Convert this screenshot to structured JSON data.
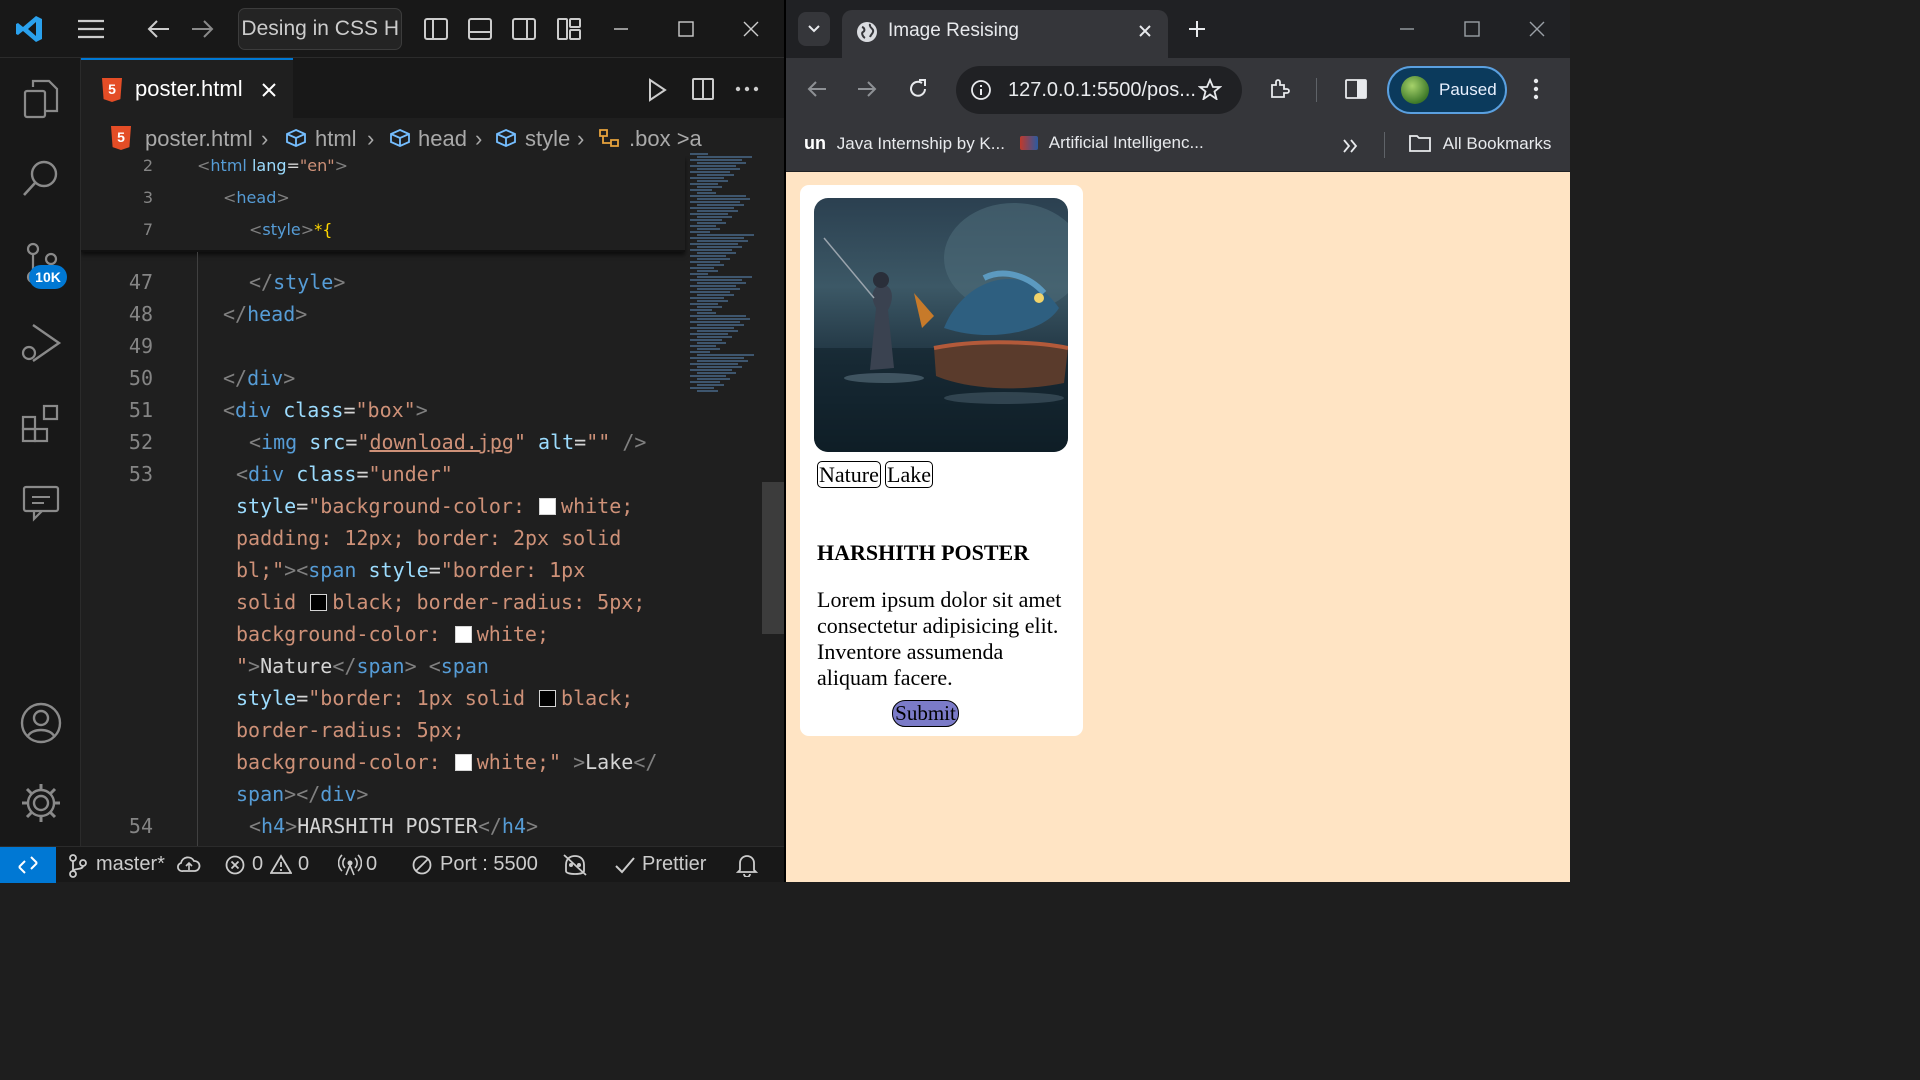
{
  "vscode": {
    "command_center": "er Desing in CSS H",
    "tab": {
      "filename": "poster.html",
      "html_badge": "5"
    },
    "breadcrumb": [
      "poster.html",
      "html",
      "head",
      "style",
      ".box >a"
    ],
    "activity_badge": "10K",
    "sticky_lines": [
      {
        "num": "2",
        "parts": [
          [
            "p",
            "<"
          ],
          [
            "t",
            "html"
          ],
          [
            "w",
            " "
          ],
          [
            "a",
            "lang"
          ],
          [
            "w",
            "="
          ],
          [
            "s",
            "\"en\""
          ],
          [
            "p",
            ">"
          ]
        ]
      },
      {
        "num": "3",
        "parts": [
          [
            "p",
            "<"
          ],
          [
            "t",
            "head"
          ],
          [
            "p",
            ">"
          ]
        ]
      },
      {
        "num": "7",
        "parts": [
          [
            "p",
            "<"
          ],
          [
            "t",
            "style"
          ],
          [
            "p",
            ">"
          ],
          [
            "y",
            "*{"
          ]
        ]
      }
    ],
    "code_lines": [
      {
        "num": "47",
        "indent": 2,
        "parts": [
          [
            "p",
            "</"
          ],
          [
            "t",
            "style"
          ],
          [
            "p",
            ">"
          ]
        ]
      },
      {
        "num": "48",
        "indent": 1,
        "parts": [
          [
            "p",
            "</"
          ],
          [
            "t",
            "head"
          ],
          [
            "p",
            ">"
          ]
        ]
      },
      {
        "num": "49",
        "indent": 0,
        "parts": []
      },
      {
        "num": "50",
        "indent": 1,
        "parts": [
          [
            "p",
            "</"
          ],
          [
            "t",
            "div"
          ],
          [
            "p",
            ">"
          ]
        ]
      },
      {
        "num": "51",
        "indent": 1,
        "parts": [
          [
            "p",
            "<"
          ],
          [
            "t",
            "div"
          ],
          [
            "w",
            " "
          ],
          [
            "a",
            "class"
          ],
          [
            "w",
            "="
          ],
          [
            "s",
            "\"box\""
          ],
          [
            "p",
            ">"
          ]
        ]
      },
      {
        "num": "52",
        "indent": 2,
        "parts": [
          [
            "p",
            "<"
          ],
          [
            "t",
            "img"
          ],
          [
            "w",
            " "
          ],
          [
            "a",
            "src"
          ],
          [
            "w",
            "="
          ],
          [
            "s",
            "\""
          ],
          [
            "u",
            "download.jpg"
          ],
          [
            "s",
            "\""
          ],
          [
            "w",
            " "
          ],
          [
            "a",
            "alt"
          ],
          [
            "w",
            "="
          ],
          [
            "s",
            "\"\""
          ],
          [
            "w",
            " "
          ],
          [
            "p",
            "/>"
          ]
        ]
      },
      {
        "num": "53",
        "indent": 1.5,
        "parts": [
          [
            "p",
            "<"
          ],
          [
            "t",
            "div"
          ],
          [
            "w",
            " "
          ],
          [
            "a",
            "class"
          ],
          [
            "w",
            "="
          ],
          [
            "s",
            "\"under\""
          ]
        ]
      },
      {
        "num": "",
        "indent": 1.5,
        "parts": [
          [
            "a",
            "style"
          ],
          [
            "w",
            "="
          ],
          [
            "s",
            "\"background-color: "
          ],
          [
            "sw",
            "#ffffff"
          ],
          [
            "s",
            "white;"
          ]
        ]
      },
      {
        "num": "",
        "indent": 1.5,
        "parts": [
          [
            "s",
            "padding: 12px; border: 2px solid"
          ]
        ]
      },
      {
        "num": "",
        "indent": 1.5,
        "parts": [
          [
            "s",
            "bl;\""
          ],
          [
            "p",
            "><"
          ],
          [
            "t",
            "span"
          ],
          [
            "w",
            " "
          ],
          [
            "a",
            "style"
          ],
          [
            "w",
            "="
          ],
          [
            "s",
            "\"border: 1px"
          ]
        ]
      },
      {
        "num": "",
        "indent": 1.5,
        "parts": [
          [
            "s",
            "solid "
          ],
          [
            "sw",
            "#000000"
          ],
          [
            "s",
            "black; border-radius: 5px;"
          ]
        ]
      },
      {
        "num": "",
        "indent": 1.5,
        "parts": [
          [
            "s",
            "background-color: "
          ],
          [
            "sw",
            "#ffffff"
          ],
          [
            "s",
            "white;"
          ]
        ]
      },
      {
        "num": "",
        "indent": 1.5,
        "parts": [
          [
            "s",
            "\""
          ],
          [
            "p",
            ">"
          ],
          [
            "w",
            "Nature"
          ],
          [
            "p",
            "</"
          ],
          [
            "t",
            "span"
          ],
          [
            "p",
            ">"
          ],
          [
            "w",
            " "
          ],
          [
            "p",
            "<"
          ],
          [
            "t",
            "span"
          ]
        ]
      },
      {
        "num": "",
        "indent": 1.5,
        "parts": [
          [
            "a",
            "style"
          ],
          [
            "w",
            "="
          ],
          [
            "s",
            "\"border: 1px solid "
          ],
          [
            "sw",
            "#000000"
          ],
          [
            "s",
            "black;"
          ]
        ]
      },
      {
        "num": "",
        "indent": 1.5,
        "parts": [
          [
            "s",
            "border-radius: 5px;"
          ]
        ]
      },
      {
        "num": "",
        "indent": 1.5,
        "parts": [
          [
            "s",
            "background-color: "
          ],
          [
            "sw",
            "#ffffff"
          ],
          [
            "s",
            "white;\""
          ],
          [
            "w",
            " "
          ],
          [
            "p",
            ">"
          ],
          [
            "w",
            "Lake"
          ],
          [
            "p",
            "</"
          ]
        ]
      },
      {
        "num": "",
        "indent": 1.5,
        "parts": [
          [
            "t",
            "span"
          ],
          [
            "p",
            "></"
          ],
          [
            "t",
            "div"
          ],
          [
            "p",
            ">"
          ]
        ]
      },
      {
        "num": "54",
        "indent": 2,
        "parts": [
          [
            "p",
            "<"
          ],
          [
            "t",
            "h4"
          ],
          [
            "p",
            ">"
          ],
          [
            "w",
            "HARSHITH POSTER"
          ],
          [
            "p",
            "</"
          ],
          [
            "t",
            "h4"
          ],
          [
            "p",
            ">"
          ]
        ]
      }
    ],
    "status": {
      "branch": "master*",
      "errors": "0",
      "warnings": "0",
      "ports": "0",
      "live_server": "Port : 5500",
      "prettier": "Prettier"
    }
  },
  "browser": {
    "tab_title": "Image Resising",
    "url": "127.0.0.1:5500/pos...",
    "profile": "Paused",
    "bookmarks": [
      "Java Internship by K...",
      "Artificial Intelligenc..."
    ],
    "bookmark_icon_text": "un",
    "all_bookmarks": "All Bookmarks",
    "page": {
      "tags": [
        "Nature",
        "Lake"
      ],
      "title": "HARSHITH POSTER",
      "body": "Lorem ipsum dolor sit amet consectetur adipisicing elit. Inventore assumenda aliquam facere.",
      "button": "Submit",
      "background": "#ffe4c4"
    }
  },
  "colors": {
    "accent": "#0078d4",
    "html_icon": "#e44d26"
  }
}
